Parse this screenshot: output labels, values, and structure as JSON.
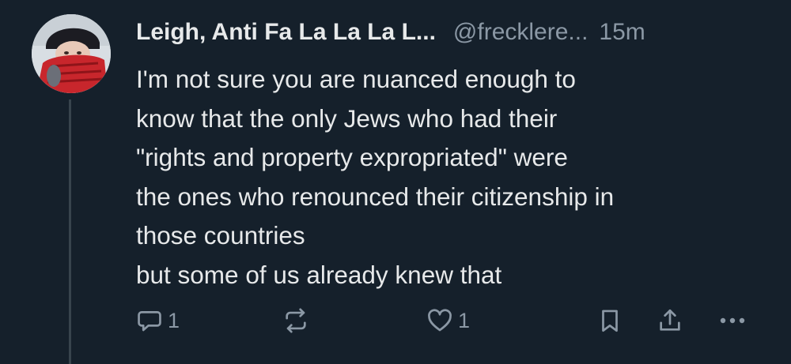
{
  "tweet": {
    "author_name": "Leigh, Anti Fa La La La L...",
    "handle": "@frecklere...",
    "timestamp": "15m",
    "text_lines": [
      "I'm not sure you are nuanced enough to",
      "know that the only Jews who had their",
      "\"rights and property expropriated\" were",
      "the ones who renounced their citizenship in",
      "those countries",
      "but some of us already knew that"
    ]
  },
  "actions": {
    "reply_icon": "reply-icon",
    "reply_count": "1",
    "retweet_icon": "retweet-icon",
    "like_icon": "heart-icon",
    "like_count": "1",
    "bookmark_icon": "bookmark-icon",
    "share_icon": "share-icon",
    "more_icon": "more-icon"
  },
  "colors": {
    "background": "#15202b",
    "text_primary": "#e7e9ea",
    "text_secondary": "#8b98a5",
    "thread_line": "#38444d"
  }
}
